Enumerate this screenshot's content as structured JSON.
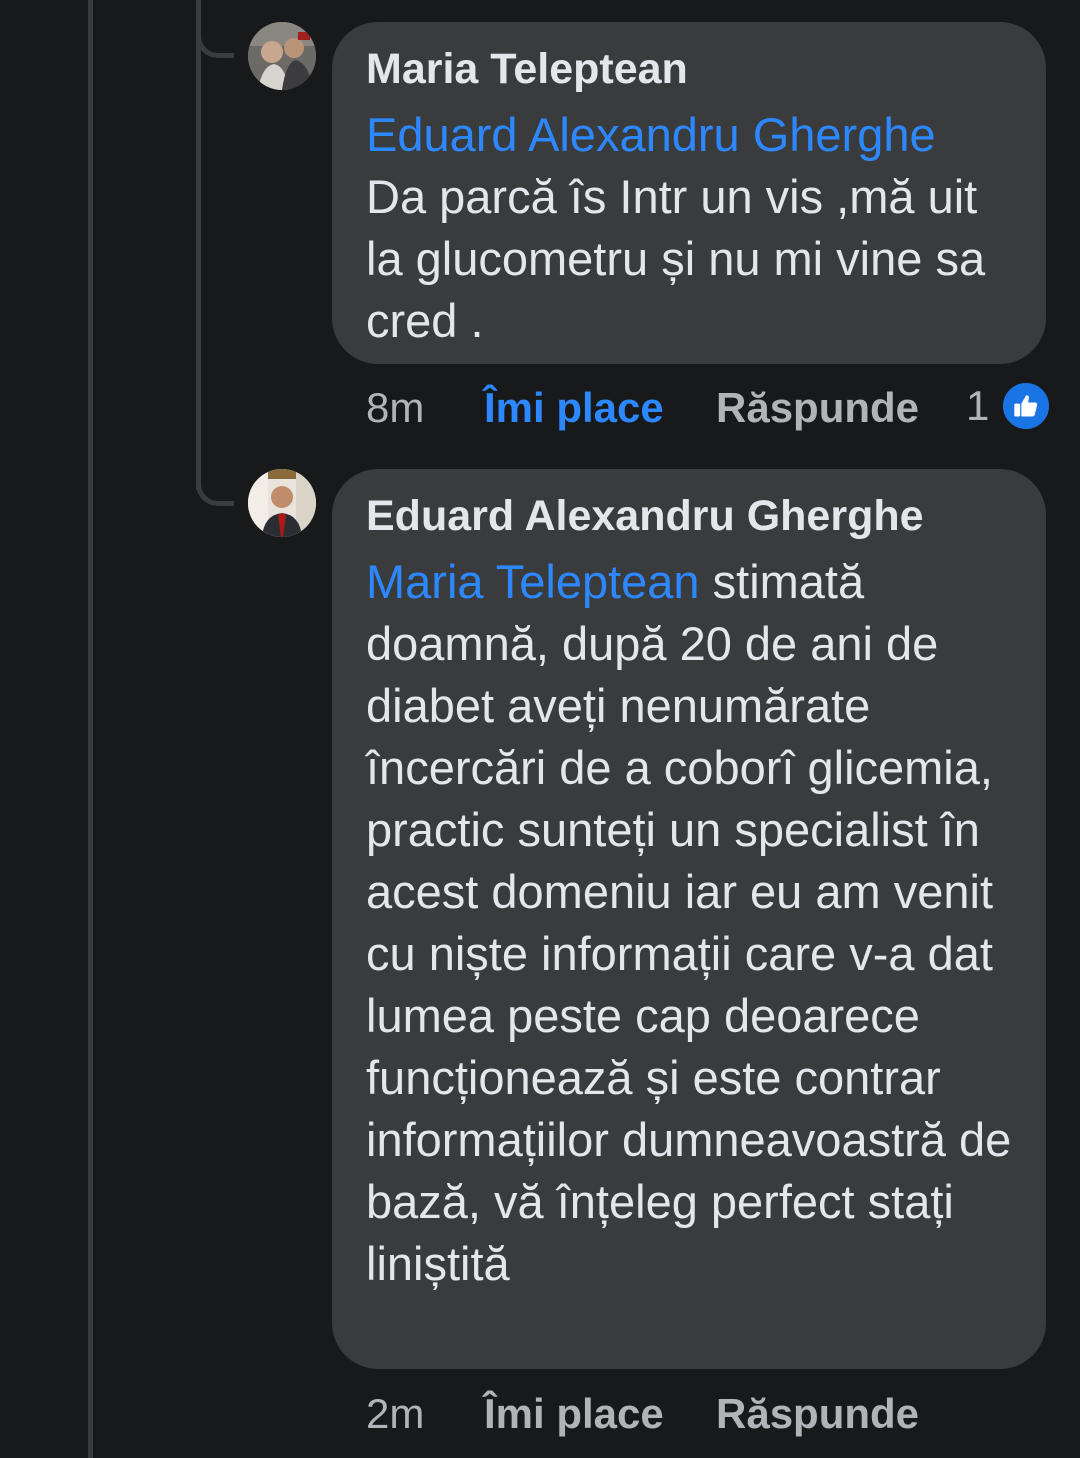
{
  "comments": [
    {
      "author": "Maria Teleptean",
      "mention": "Eduard Alexandru Gherghe",
      "text": "Da parcă îs Intr un vis ,mă uit la glucometru și nu mi vine sa cred .",
      "time": "8m",
      "like_label": "Îmi place",
      "reply_label": "Răspunde",
      "reaction_count": "1",
      "reaction_icon": "thumbs-up-icon",
      "liked": true
    },
    {
      "author": "Eduard Alexandru Gherghe",
      "mention": "Maria Teleptean",
      "text": " stimată doamnă, după 20 de ani de diabet aveți nenumărate încercări de a coborî glicemia, practic sunteți un specialist în acest domeniu iar eu am venit cu niște informații care v-a dat lumea peste cap deoarece funcționează și este contrar informațiilor dumneavoastră de bază, vă înțeleg perfect stați liniștită",
      "time": "2m",
      "like_label": "Îmi place",
      "reply_label": "Răspunde",
      "liked": false
    }
  ],
  "colors": {
    "background": "#18191a",
    "bubble": "#3a3b3c",
    "text": "#e4e6eb",
    "secondary_text": "#b0b3b8",
    "mention": "#2d88ff",
    "like_badge": "#1b74e4"
  }
}
